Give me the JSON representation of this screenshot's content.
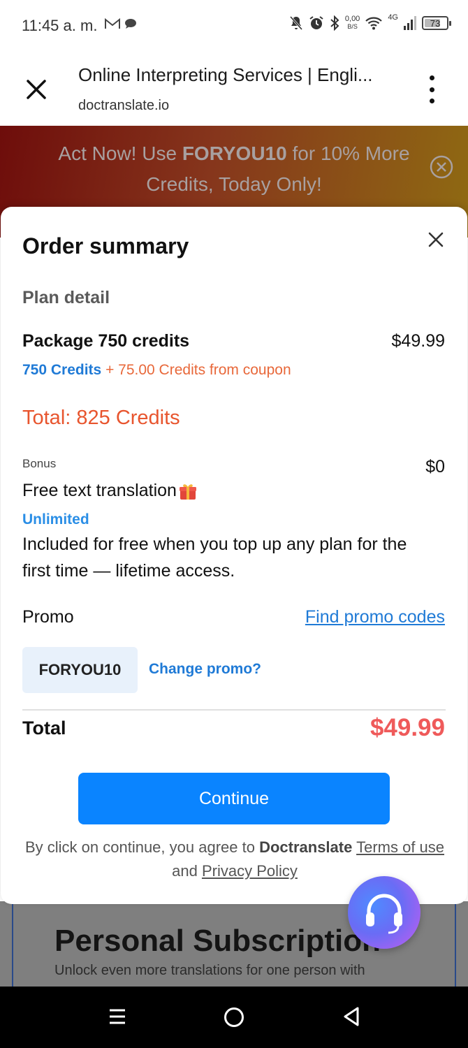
{
  "status_bar": {
    "time": "11:45 a. m.",
    "net_speed_value": "0,00",
    "net_speed_unit": "B/S",
    "network": "4G",
    "battery": "73",
    "battery_level": 0.73,
    "icons": [
      "gmail-icon",
      "chat-bubble-icon",
      "mute-icon",
      "alarm-icon",
      "bluetooth-icon",
      "wifi-icon",
      "signal-icon",
      "battery-icon"
    ]
  },
  "browser": {
    "title": "Online Interpreting Services | Engli...",
    "url": "doctranslate.io"
  },
  "banner": {
    "text_before": "Act Now! Use ",
    "code": "FORYOU10",
    "text_after": " for 10% More Credits, Today Only!"
  },
  "modal": {
    "title": "Order summary",
    "plan_detail_label": "Plan detail",
    "package_name": "Package 750 credits",
    "package_price": "$49.99",
    "credits_base": "750 Credits",
    "credits_coupon": " + 75.00 Credits from coupon",
    "total_credits": "Total: 825 Credits",
    "bonus_label": "Bonus",
    "bonus_price": "$0",
    "bonus_name": "Free text translation",
    "bonus_badge": "Unlimited",
    "bonus_desc": "Included for free when you top up any plan for the first time — lifetime access.",
    "promo_label": "Promo",
    "find_promo": "Find promo codes",
    "promo_code": "FORYOU10",
    "change_promo": "Change promo?",
    "total_label": "Total",
    "total_price": "$49.99",
    "continue_label": "Continue",
    "terms_prefix": "By click on continue, you agree to ",
    "terms_brand": "Doctranslate",
    "terms_space": " ",
    "terms_link": "Terms of use",
    "terms_and": " and ",
    "privacy_link": "Privacy Policy"
  },
  "background_page": {
    "section_title": "Personal Subscription",
    "section_subtitle": "Unlock even more translations for one person with"
  },
  "colors": {
    "accent_blue": "#0a84ff",
    "link_blue": "#1f7ad6",
    "coupon_orange": "#e8683a",
    "total_credits_red": "#e8552e",
    "price_red": "#ef5a5a"
  }
}
